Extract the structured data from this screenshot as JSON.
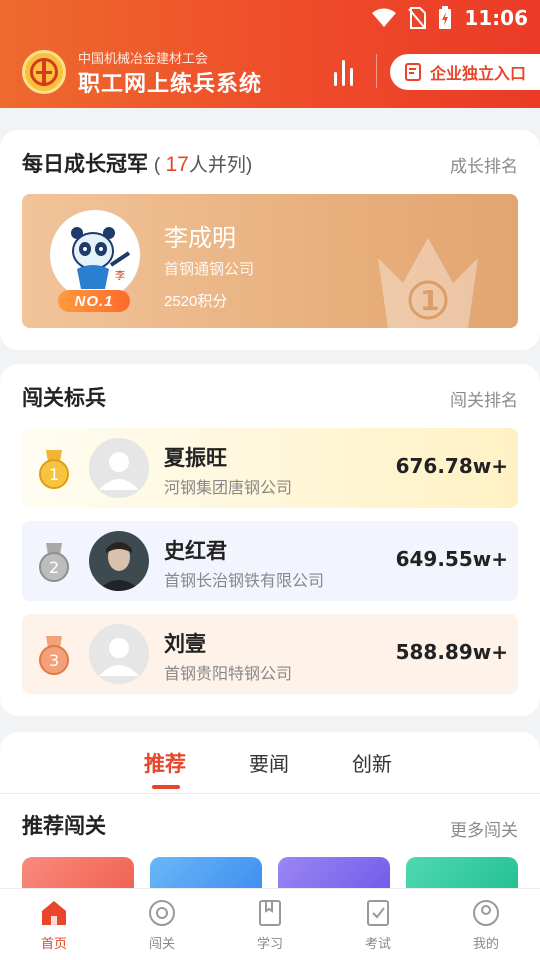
{
  "status_bar": {
    "time": "11:06"
  },
  "header": {
    "org_name": "中国机械冶金建材工会",
    "app_title": "职工网上练兵系统",
    "entry_button": "企业独立入口"
  },
  "champion_section": {
    "title": "每日成长冠军",
    "tie_prefix": "( ",
    "tie_count": "17",
    "tie_suffix": "人并列)",
    "link": "成长排名",
    "champion": {
      "badge": "NO.1",
      "name": "李成明",
      "company": "首钢通钢公司",
      "points": "2520积分",
      "crown_number": "1"
    }
  },
  "checkpoint_section": {
    "title": "闯关标兵",
    "link": "闯关排名",
    "ranks": [
      {
        "medal": "1",
        "name": "夏振旺",
        "company": "河钢集团唐钢公司",
        "score": "676.78w+"
      },
      {
        "medal": "2",
        "name": "史红君",
        "company": "首钢长治钢铁有限公司",
        "score": "649.55w+"
      },
      {
        "medal": "3",
        "name": "刘壹",
        "company": "首钢贵阳特钢公司",
        "score": "588.89w+"
      }
    ]
  },
  "tabs": [
    "推荐",
    "要闻",
    "创新"
  ],
  "recommend_section": {
    "title": "推荐闯关",
    "link": "更多闯关"
  },
  "bottom_nav": [
    "首页",
    "闯关",
    "学习",
    "考试",
    "我的"
  ],
  "colors": {
    "accent": "#e8452b",
    "gold": "#f3b33a",
    "silver": "#9a9a9a",
    "bronze": "#ef8d5c"
  }
}
